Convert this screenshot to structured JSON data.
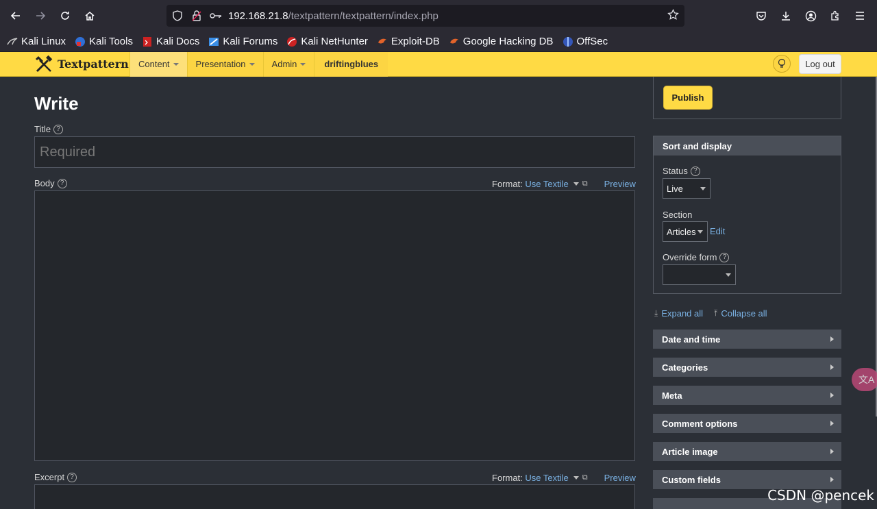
{
  "browser": {
    "url_host": "192.168.21.8",
    "url_path": "/textpattern/textpattern/index.php",
    "bookmarks": [
      "Kali Linux",
      "Kali Tools",
      "Kali Docs",
      "Kali Forums",
      "Kali NetHunter",
      "Exploit-DB",
      "Google Hacking DB",
      "OffSec"
    ]
  },
  "header": {
    "logo_text": "Textpattern",
    "nav": [
      "Content",
      "Presentation",
      "Admin"
    ],
    "site_name": "driftingblues",
    "logout_label": "Log out"
  },
  "write": {
    "page_title": "Write",
    "title_label": "Title",
    "title_placeholder": "Required",
    "body_label": "Body",
    "format_label": "Format:",
    "format_value": "Use Textile",
    "preview_label": "Preview",
    "excerpt_label": "Excerpt"
  },
  "sidebar": {
    "publish_label": "Publish",
    "sort_title": "Sort and display",
    "status_label": "Status",
    "status_value": "Live",
    "section_label": "Section",
    "section_value": "Articles",
    "section_edit": "Edit",
    "override_label": "Override form",
    "override_value": "",
    "expand_all": "Expand all",
    "collapse_all": "Collapse all",
    "panels": [
      "Date and time",
      "Categories",
      "Meta",
      "Comment options",
      "Article image",
      "Custom fields"
    ]
  },
  "overlay": {
    "watermark": "CSDN @pencek"
  },
  "colors": {
    "accent": "#ffda44",
    "link": "#7ab1e3",
    "background": "#2b2f36"
  }
}
